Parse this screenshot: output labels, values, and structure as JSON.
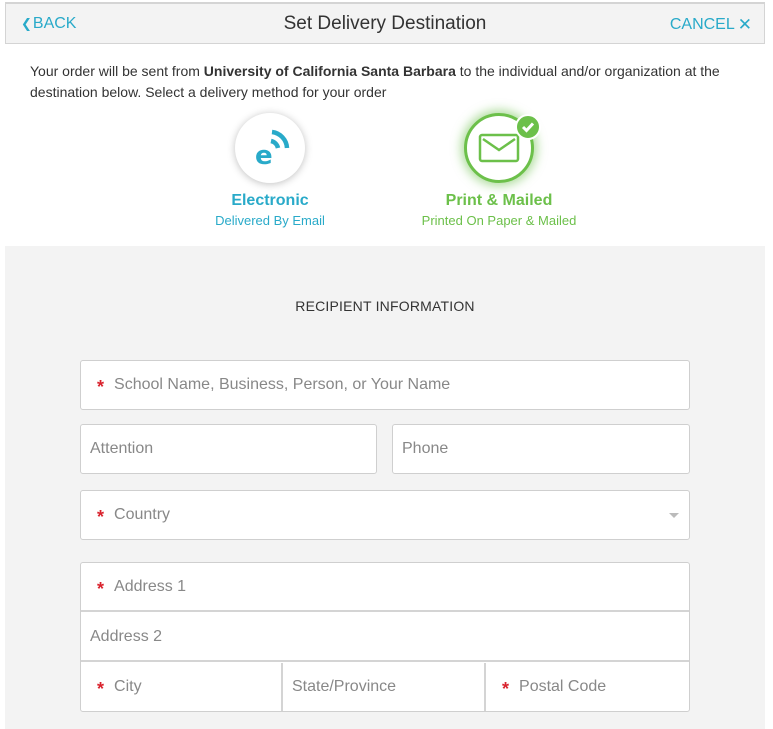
{
  "header": {
    "back_label": "BACK",
    "title": "Set Delivery Destination",
    "cancel_label": "CANCEL"
  },
  "intro": {
    "prefix": "Your order will be sent from ",
    "institution": "University of California Santa Barbara",
    "suffix": " to the individual and/or organization at the destination below. Select a delivery method for your order"
  },
  "delivery_methods": [
    {
      "label": "Electronic",
      "sublabel": "Delivered By Email",
      "icon": "e-delivery-icon",
      "selected": false
    },
    {
      "label": "Print & Mailed",
      "sublabel": "Printed On Paper & Mailed",
      "icon": "envelope-icon",
      "selected": true
    }
  ],
  "colors": {
    "accent_blue": "#29aac9",
    "accent_green": "#6cc04a",
    "required_red": "#d9232d"
  },
  "form": {
    "section_title": "RECIPIENT INFORMATION",
    "name_placeholder": "School Name, Business, Person, or Your Name",
    "attention_placeholder": "Attention",
    "phone_placeholder": "Phone",
    "country_placeholder": "Country",
    "address1_placeholder": "Address 1",
    "address2_placeholder": "Address 2",
    "city_placeholder": "City",
    "state_placeholder": "State/Province",
    "postal_placeholder": "Postal Code",
    "required_mark": "*"
  }
}
